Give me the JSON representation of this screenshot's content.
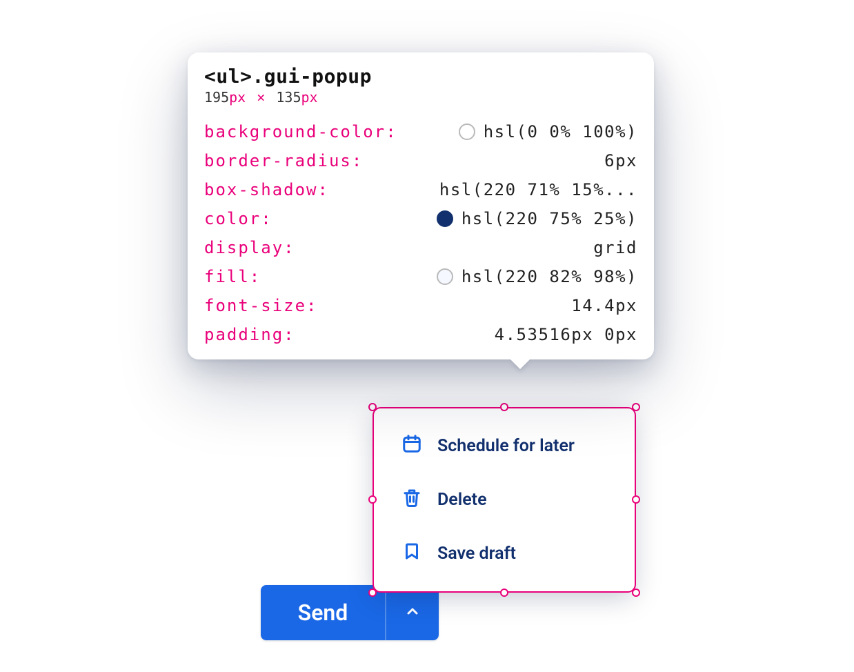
{
  "inspector": {
    "element_tag": "<ul>",
    "element_class": ".gui-popup",
    "width": "195",
    "width_unit": "px",
    "sep": "×",
    "height": "135",
    "height_unit": "px",
    "props": [
      {
        "name": "background-color",
        "value": "hsl(0 0% 100%)",
        "swatch": "white"
      },
      {
        "name": "border-radius",
        "value": "6px",
        "swatch": ""
      },
      {
        "name": "box-shadow",
        "value": "hsl(220 71% 15%...",
        "swatch": ""
      },
      {
        "name": "color",
        "value": "hsl(220 75% 25%)",
        "swatch": "navy"
      },
      {
        "name": "display",
        "value": "grid",
        "swatch": ""
      },
      {
        "name": "fill",
        "value": "hsl(220 82% 98%)",
        "swatch": "pale"
      },
      {
        "name": "font-size",
        "value": "14.4px",
        "swatch": ""
      },
      {
        "name": "padding",
        "value": "4.53516px 0px",
        "swatch": ""
      }
    ]
  },
  "popup": {
    "items": [
      {
        "icon": "calendar-icon",
        "label": "Schedule for later"
      },
      {
        "icon": "trash-icon",
        "label": "Delete"
      },
      {
        "icon": "bookmark-icon",
        "label": "Save draft"
      }
    ]
  },
  "send": {
    "label": "Send"
  }
}
